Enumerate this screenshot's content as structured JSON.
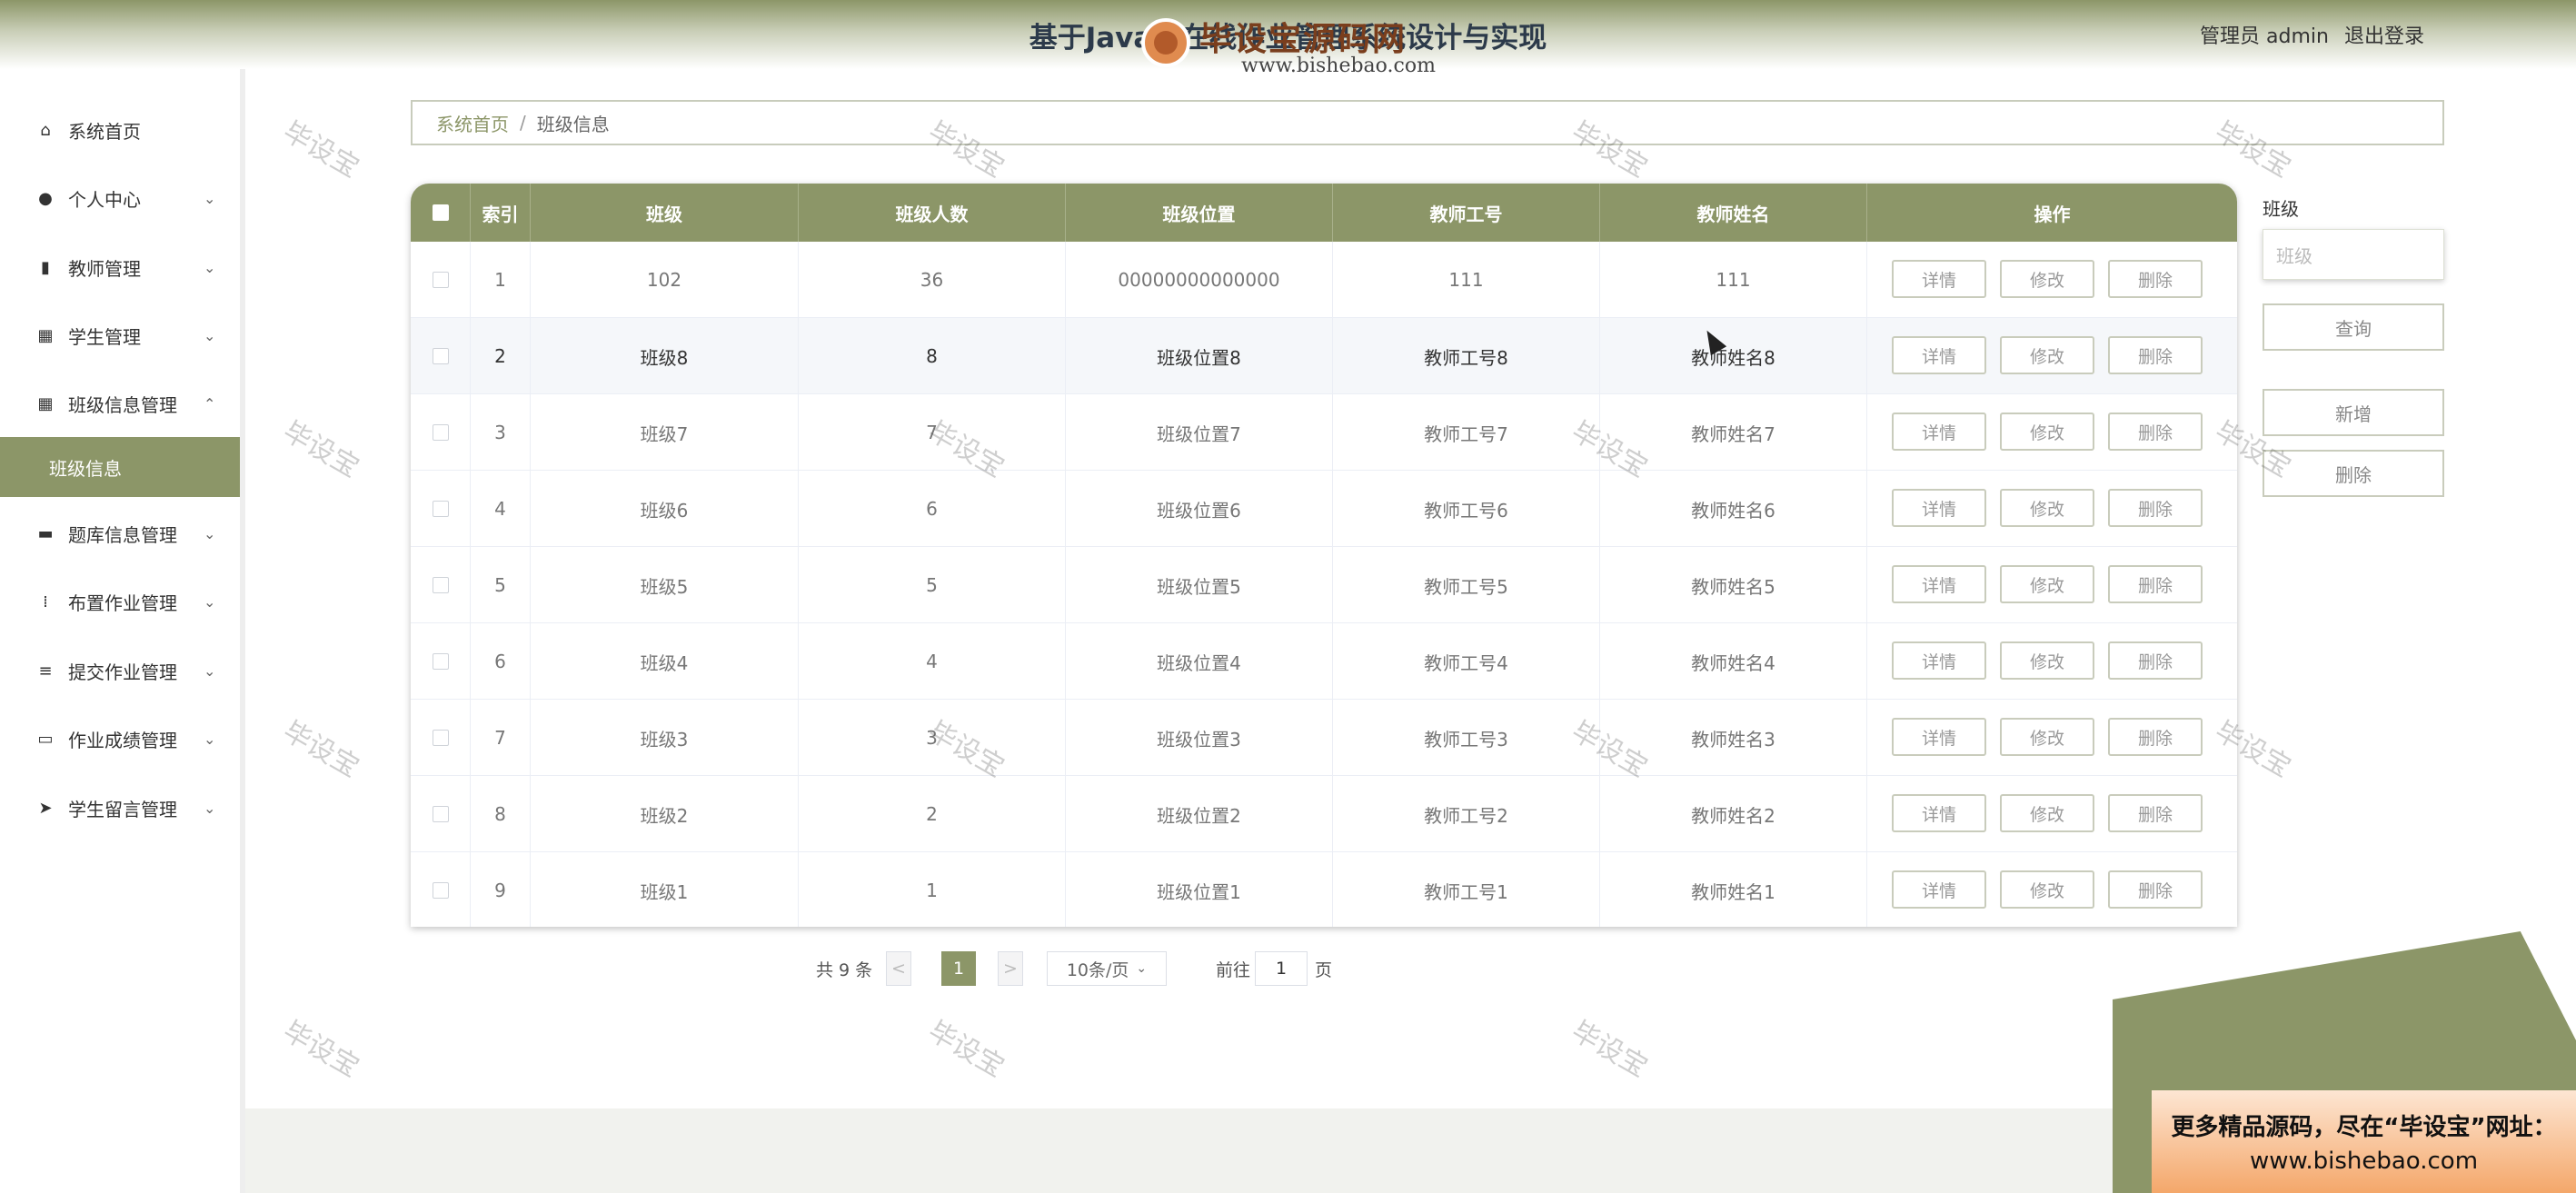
{
  "header": {
    "title": "基于Java的在线作业管理系统设计与实现",
    "role_label": "管理员 admin",
    "logout_label": "退出登录"
  },
  "logo": {
    "brand": "毕设宝源码网",
    "url": "www.bishebao.com"
  },
  "sidebar": {
    "items": [
      {
        "label": "系统首页",
        "icon": "home-icon",
        "expandable": false
      },
      {
        "label": "个人中心",
        "icon": "user-icon",
        "expandable": true
      },
      {
        "label": "教师管理",
        "icon": "bar-chart-icon",
        "expandable": true
      },
      {
        "label": "学生管理",
        "icon": "grid-icon",
        "expandable": true
      },
      {
        "label": "班级信息管理",
        "icon": "grid-icon",
        "expandable": true,
        "expanded": true
      },
      {
        "label": "题库信息管理",
        "icon": "ticket-icon",
        "expandable": true
      },
      {
        "label": "布置作业管理",
        "icon": "apps-icon",
        "expandable": true
      },
      {
        "label": "提交作业管理",
        "icon": "sliders-icon",
        "expandable": true
      },
      {
        "label": "作业成绩管理",
        "icon": "monitor-icon",
        "expandable": true
      },
      {
        "label": "学生留言管理",
        "icon": "send-icon",
        "expandable": true
      }
    ],
    "sub_active": "班级信息",
    "chev_down": "⌄",
    "chev_up": "⌃"
  },
  "breadcrumb": {
    "home": "系统首页",
    "separator": "/",
    "current": "班级信息"
  },
  "table": {
    "columns": [
      "",
      "索引",
      "班级",
      "班级人数",
      "班级位置",
      "教师工号",
      "教师姓名",
      "操作"
    ],
    "rows": [
      {
        "index": "1",
        "cls": "102",
        "count": "36",
        "location": "00000000000000",
        "teacher_id": "111",
        "teacher_name": "111"
      },
      {
        "index": "2",
        "cls": "班级8",
        "count": "8",
        "location": "班级位置8",
        "teacher_id": "教师工号8",
        "teacher_name": "教师姓名8"
      },
      {
        "index": "3",
        "cls": "班级7",
        "count": "7",
        "location": "班级位置7",
        "teacher_id": "教师工号7",
        "teacher_name": "教师姓名7"
      },
      {
        "index": "4",
        "cls": "班级6",
        "count": "6",
        "location": "班级位置6",
        "teacher_id": "教师工号6",
        "teacher_name": "教师姓名6"
      },
      {
        "index": "5",
        "cls": "班级5",
        "count": "5",
        "location": "班级位置5",
        "teacher_id": "教师工号5",
        "teacher_name": "教师姓名5"
      },
      {
        "index": "6",
        "cls": "班级4",
        "count": "4",
        "location": "班级位置4",
        "teacher_id": "教师工号4",
        "teacher_name": "教师姓名4"
      },
      {
        "index": "7",
        "cls": "班级3",
        "count": "3",
        "location": "班级位置3",
        "teacher_id": "教师工号3",
        "teacher_name": "教师姓名3"
      },
      {
        "index": "8",
        "cls": "班级2",
        "count": "2",
        "location": "班级位置2",
        "teacher_id": "教师工号2",
        "teacher_name": "教师姓名2"
      },
      {
        "index": "9",
        "cls": "班级1",
        "count": "1",
        "location": "班级位置1",
        "teacher_id": "教师工号1",
        "teacher_name": "教师姓名1"
      }
    ],
    "actions": [
      "详情",
      "修改",
      "删除"
    ]
  },
  "pagination": {
    "total_label": "共 9 条",
    "prev": "<",
    "page": "1",
    "next": ">",
    "page_size": "10条/页",
    "goto_label": "前往",
    "goto_value": "1",
    "page_unit": "页"
  },
  "search": {
    "label": "班级",
    "placeholder": "班级",
    "query_button": "查询",
    "add_button": "新增",
    "delete_button": "删除"
  },
  "watermark": "毕设宝",
  "promo": {
    "line1": "更多精品源码，尽在“毕设宝”网址：",
    "line2": "www.bishebao.com"
  },
  "colors": {
    "accent": "#8c9668",
    "header_text": "#2c3a4a"
  }
}
